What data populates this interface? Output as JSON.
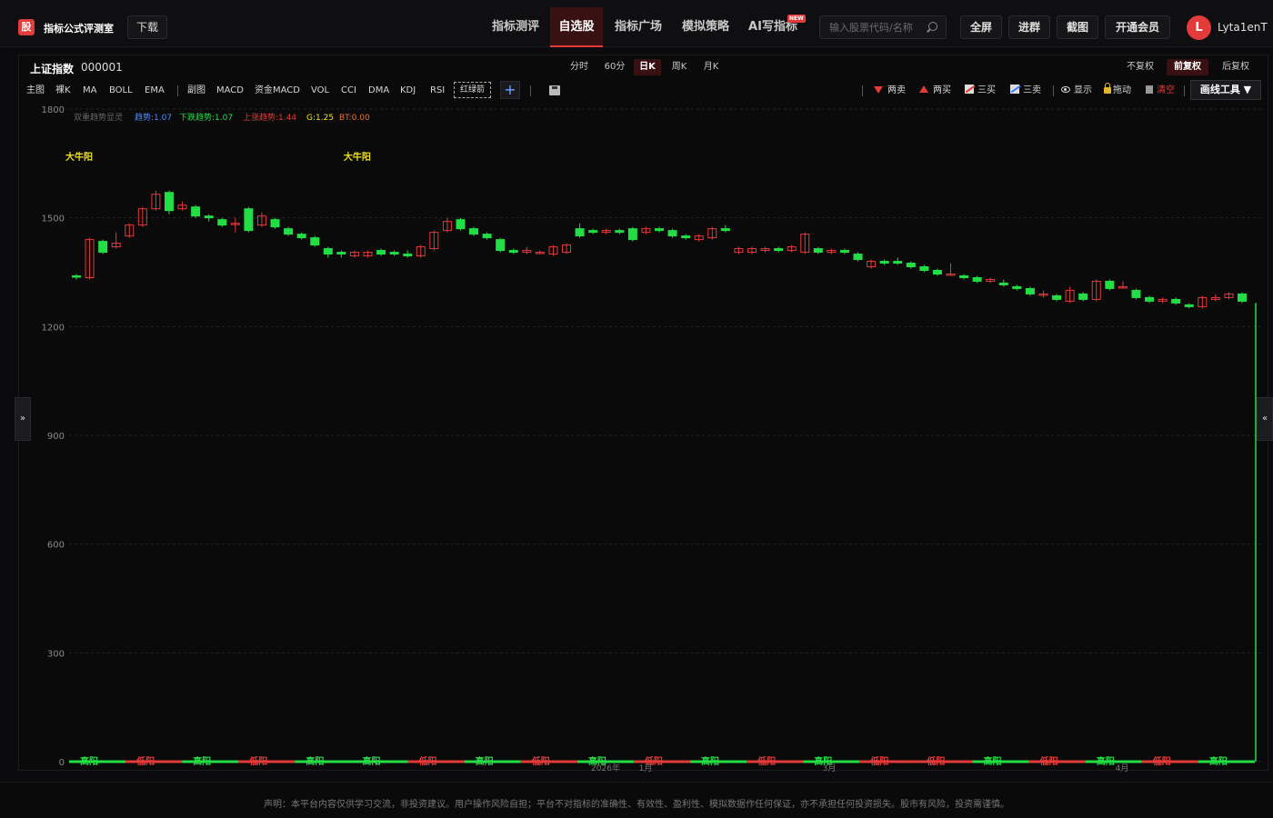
{
  "header": {
    "logo_char": "股",
    "app_title": "指标公式评测室",
    "download_label": "下载",
    "nav": [
      {
        "label": "指标测评",
        "active": false
      },
      {
        "label": "自选股",
        "active": true
      },
      {
        "label": "指标广场",
        "active": false
      },
      {
        "label": "模拟策略",
        "active": false
      },
      {
        "label": "AI写指标",
        "active": false
      }
    ],
    "new_badge": "NEW",
    "search_placeholder": "输入股票代码/名称",
    "buttons": [
      "全屏",
      "进群",
      "截图",
      "开通会员"
    ],
    "avatar_letter": "L",
    "username": "Lyta1enT"
  },
  "stock": {
    "name": "上证指数",
    "code": "000001"
  },
  "periods": [
    {
      "label": "分时",
      "active": false
    },
    {
      "label": "60分",
      "active": false
    },
    {
      "label": "日K",
      "active": true
    },
    {
      "label": "周K",
      "active": false
    },
    {
      "label": "月K",
      "active": false
    }
  ],
  "adjust": [
    {
      "label": "不复权",
      "active": false
    },
    {
      "label": "前复权",
      "active": true
    },
    {
      "label": "后复权",
      "active": false
    }
  ],
  "indicators_main": [
    "主图",
    "裸K",
    "MA",
    "BOLL",
    "EMA"
  ],
  "indicators_sub": [
    "副图",
    "MACD",
    "资金MACD",
    "VOL",
    "CCI",
    "DMA",
    "KDJ",
    "RSI"
  ],
  "highlight_label": "红绿箭",
  "plus_label": "+",
  "tools": {
    "sell2": "两卖",
    "buy2": "两买",
    "buy3": "三买",
    "sell3": "三卖",
    "show": "显示",
    "drag": "拖动",
    "clear": "清空",
    "draw_tools": "画线工具 ▼"
  },
  "legend": {
    "name": "双重趋势显灵",
    "items": [
      {
        "label": "趋势:1.07",
        "color": "#4a8cff"
      },
      {
        "label": "下跌趋势:1.07",
        "color": "#22dd44"
      },
      {
        "label": "上涨趋势:1.44",
        "color": "#e33a3a"
      },
      {
        "label": "G:1.25",
        "color": "#f0e020"
      },
      {
        "label": "BT:0.00",
        "color": "#f07020"
      }
    ]
  },
  "side_left": "»",
  "side_right": "«",
  "footer": "声明：本平台内容仅供学习交流，非投资建议。用户操作风险自担；平台不对指标的准确性、有效性、盈利性、模拟数据作任何保证，亦不承担任何投资损失。股市有风险，投资需谨慎。",
  "chart_data": {
    "type": "candlestick",
    "y_ticks": [
      1800,
      1500,
      1200,
      900,
      600,
      300,
      0
    ],
    "ylim": [
      0,
      1800
    ],
    "grid": true,
    "up_color": "#e33a3a",
    "down_color": "#22dd44",
    "annotations": [
      {
        "label": "大牛阳",
        "index": 0
      },
      {
        "label": "大牛阳",
        "index": 21
      }
    ],
    "x_labels": [
      "2026年",
      "1月",
      "3月",
      "4月"
    ],
    "candles": [
      [
        1340,
        1338,
        1345,
        1330
      ],
      [
        1335,
        1440,
        1445,
        1330
      ],
      [
        1435,
        1405,
        1440,
        1400
      ],
      [
        1420,
        1430,
        1460,
        1415
      ],
      [
        1450,
        1480,
        1485,
        1445
      ],
      [
        1480,
        1525,
        1530,
        1475
      ],
      [
        1525,
        1565,
        1575,
        1520
      ],
      [
        1570,
        1520,
        1575,
        1510
      ],
      [
        1525,
        1535,
        1545,
        1520
      ],
      [
        1530,
        1505,
        1535,
        1500
      ],
      [
        1505,
        1500,
        1510,
        1490
      ],
      [
        1495,
        1480,
        1500,
        1475
      ],
      [
        1485,
        1485,
        1500,
        1460
      ],
      [
        1525,
        1465,
        1530,
        1460
      ],
      [
        1480,
        1505,
        1515,
        1475
      ],
      [
        1495,
        1475,
        1500,
        1470
      ],
      [
        1470,
        1455,
        1475,
        1450
      ],
      [
        1455,
        1445,
        1460,
        1440
      ],
      [
        1445,
        1425,
        1450,
        1420
      ],
      [
        1415,
        1400,
        1420,
        1390
      ],
      [
        1405,
        1400,
        1410,
        1390
      ],
      [
        1395,
        1405,
        1410,
        1390
      ],
      [
        1395,
        1405,
        1410,
        1390
      ],
      [
        1410,
        1400,
        1415,
        1395
      ],
      [
        1405,
        1400,
        1410,
        1395
      ],
      [
        1400,
        1395,
        1410,
        1390
      ],
      [
        1395,
        1420,
        1425,
        1390
      ],
      [
        1415,
        1460,
        1465,
        1410
      ],
      [
        1465,
        1490,
        1500,
        1460
      ],
      [
        1495,
        1470,
        1500,
        1465
      ],
      [
        1470,
        1455,
        1475,
        1450
      ],
      [
        1455,
        1445,
        1460,
        1440
      ],
      [
        1440,
        1410,
        1445,
        1405
      ],
      [
        1410,
        1405,
        1415,
        1400
      ],
      [
        1405,
        1410,
        1420,
        1400
      ],
      [
        1405,
        1405,
        1410,
        1400
      ],
      [
        1400,
        1420,
        1425,
        1395
      ],
      [
        1405,
        1425,
        1430,
        1400
      ],
      [
        1470,
        1450,
        1485,
        1445
      ],
      [
        1465,
        1460,
        1470,
        1455
      ],
      [
        1460,
        1465,
        1470,
        1455
      ],
      [
        1465,
        1460,
        1470,
        1455
      ],
      [
        1470,
        1440,
        1475,
        1435
      ],
      [
        1460,
        1470,
        1475,
        1455
      ],
      [
        1470,
        1465,
        1475,
        1460
      ],
      [
        1465,
        1450,
        1470,
        1445
      ],
      [
        1450,
        1445,
        1455,
        1440
      ],
      [
        1440,
        1450,
        1455,
        1435
      ],
      [
        1445,
        1470,
        1475,
        1440
      ],
      [
        1470,
        1465,
        1480,
        1460
      ],
      [
        1405,
        1415,
        1420,
        1400
      ],
      [
        1405,
        1415,
        1420,
        1400
      ],
      [
        1410,
        1415,
        1420,
        1405
      ],
      [
        1415,
        1410,
        1420,
        1405
      ],
      [
        1410,
        1420,
        1425,
        1405
      ],
      [
        1405,
        1455,
        1460,
        1400
      ],
      [
        1415,
        1405,
        1420,
        1400
      ],
      [
        1405,
        1410,
        1415,
        1400
      ],
      [
        1410,
        1405,
        1415,
        1400
      ],
      [
        1400,
        1385,
        1405,
        1380
      ],
      [
        1365,
        1380,
        1385,
        1360
      ],
      [
        1380,
        1375,
        1385,
        1370
      ],
      [
        1380,
        1375,
        1390,
        1370
      ],
      [
        1375,
        1365,
        1380,
        1360
      ],
      [
        1365,
        1355,
        1370,
        1350
      ],
      [
        1355,
        1345,
        1360,
        1340
      ],
      [
        1345,
        1345,
        1375,
        1340
      ],
      [
        1340,
        1335,
        1345,
        1330
      ],
      [
        1335,
        1325,
        1340,
        1320
      ],
      [
        1325,
        1330,
        1335,
        1320
      ],
      [
        1320,
        1315,
        1330,
        1310
      ],
      [
        1310,
        1305,
        1315,
        1300
      ],
      [
        1305,
        1290,
        1310,
        1285
      ],
      [
        1290,
        1290,
        1300,
        1280
      ],
      [
        1285,
        1275,
        1290,
        1270
      ],
      [
        1270,
        1300,
        1310,
        1265
      ],
      [
        1290,
        1275,
        1295,
        1270
      ],
      [
        1275,
        1325,
        1330,
        1270
      ],
      [
        1325,
        1305,
        1330,
        1300
      ],
      [
        1310,
        1310,
        1325,
        1305
      ],
      [
        1300,
        1280,
        1305,
        1275
      ],
      [
        1280,
        1270,
        1285,
        1265
      ],
      [
        1270,
        1275,
        1280,
        1265
      ],
      [
        1275,
        1265,
        1280,
        1260
      ],
      [
        1260,
        1255,
        1265,
        1250
      ],
      [
        1255,
        1280,
        1285,
        1250
      ],
      [
        1275,
        1280,
        1290,
        1270
      ],
      [
        1280,
        1290,
        1295,
        1275
      ],
      [
        1290,
        1270,
        1295,
        1265
      ]
    ],
    "bottom_labels": [
      {
        "label": "高阳",
        "color": "#22dd44"
      },
      {
        "label": "低阳",
        "color": "#e33a3a"
      },
      {
        "label": "高阳",
        "color": "#22dd44"
      },
      {
        "label": "低阳",
        "color": "#e33a3a"
      },
      {
        "label": "高阳",
        "color": "#22dd44"
      },
      {
        "label": "高阳",
        "color": "#22dd44"
      },
      {
        "label": "低阳",
        "color": "#e33a3a"
      },
      {
        "label": "高阳",
        "color": "#22dd44"
      },
      {
        "label": "低阳",
        "color": "#e33a3a"
      },
      {
        "label": "高阳",
        "color": "#22dd44"
      },
      {
        "label": "低阳",
        "color": "#e33a3a"
      },
      {
        "label": "高阳",
        "color": "#22dd44"
      },
      {
        "label": "低阳",
        "color": "#e33a3a"
      },
      {
        "label": "高阳",
        "color": "#22dd44"
      },
      {
        "label": "低阳",
        "color": "#e33a3a"
      },
      {
        "label": "低阳",
        "color": "#e33a3a"
      },
      {
        "label": "高阳",
        "color": "#22dd44"
      },
      {
        "label": "低阳",
        "color": "#e33a3a"
      },
      {
        "label": "高阳",
        "color": "#22dd44"
      },
      {
        "label": "低阳",
        "color": "#e33a3a"
      },
      {
        "label": "高阳",
        "color": "#22dd44"
      }
    ]
  }
}
